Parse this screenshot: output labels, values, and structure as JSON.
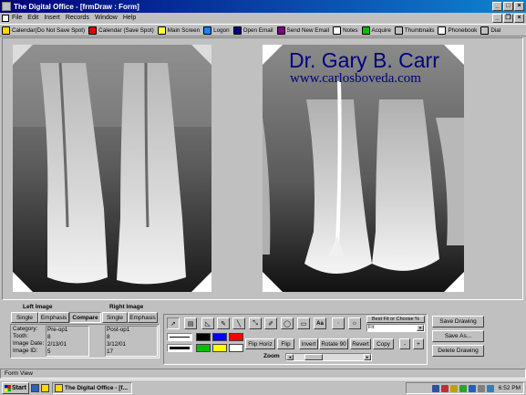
{
  "window": {
    "title": "The Digital Office - [frmDraw : Form]"
  },
  "menu": {
    "items": [
      "File",
      "Edit",
      "Insert",
      "Records",
      "Window",
      "Help"
    ]
  },
  "toolbar": {
    "items": [
      {
        "label": "Calendar(Do Not Save Spot)",
        "icon": "calendar-icon",
        "color": "#ffd800"
      },
      {
        "label": "Calendar (Save Spot)",
        "icon": "calendar-save-icon",
        "color": "#e00000"
      },
      {
        "label": "Main Screen",
        "icon": "smiley-icon",
        "color": "#ffff40"
      },
      {
        "label": "Logon",
        "icon": "logon-icon",
        "color": "#2080ff"
      },
      {
        "label": "Open Email",
        "icon": "email-open-icon",
        "color": "#000080"
      },
      {
        "label": "Send New Email",
        "icon": "email-send-icon",
        "color": "#800080"
      },
      {
        "label": "Notes",
        "icon": "notes-icon",
        "color": "#ffffff"
      },
      {
        "label": "Acquire",
        "icon": "acquire-icon",
        "color": "#00c000"
      },
      {
        "label": "Thumbnails",
        "icon": "thumbnails-icon",
        "color": "#c0c0c0"
      },
      {
        "label": "Phonebook",
        "icon": "phonebook-icon",
        "color": "#ffffff"
      },
      {
        "label": "Dial",
        "icon": "phone-icon",
        "color": "#c0c0c0"
      }
    ]
  },
  "watermark": {
    "name": "Dr. Gary B. Carr",
    "url": "www.carlosboveda.com",
    "color": "#000080"
  },
  "left_image": {
    "heading": "Left Image",
    "buttons": [
      "Single",
      "Emphasis",
      "Compare"
    ],
    "fields": [
      {
        "label": "Category:",
        "value": "Pre-op1"
      },
      {
        "label": "Tooth:",
        "value": "8"
      },
      {
        "label": "Image Date:",
        "value": "2/13/01"
      },
      {
        "label": "Image ID:",
        "value": "5"
      }
    ]
  },
  "right_image": {
    "heading": "Right Image",
    "buttons": [
      "Single",
      "Emphasis"
    ],
    "values": [
      "Post-op1",
      "8",
      "3/12/01",
      "17"
    ]
  },
  "tools": {
    "text_tool": "Aa",
    "colors": [
      "#000000",
      "#0000ff",
      "#ff0000",
      "#00c000",
      "#ffff00",
      "#ffffff"
    ],
    "fit_label": "Best Fit or Choose %",
    "fit_value": "Fit",
    "buttons": [
      "Flip Horiz",
      "Flip",
      "Invert",
      "Rotate 90",
      "Revert",
      "Copy"
    ],
    "minus": "-",
    "plus": "+",
    "zoom_label": "Zoom"
  },
  "actions": {
    "save": "Save Drawing",
    "save_as": "Save As...",
    "delete": "Delete Drawing"
  },
  "status": {
    "text": "Form View"
  },
  "taskbar": {
    "start": "Start",
    "task": "The Digital Office - [f...",
    "clock": "6:52 PM"
  }
}
